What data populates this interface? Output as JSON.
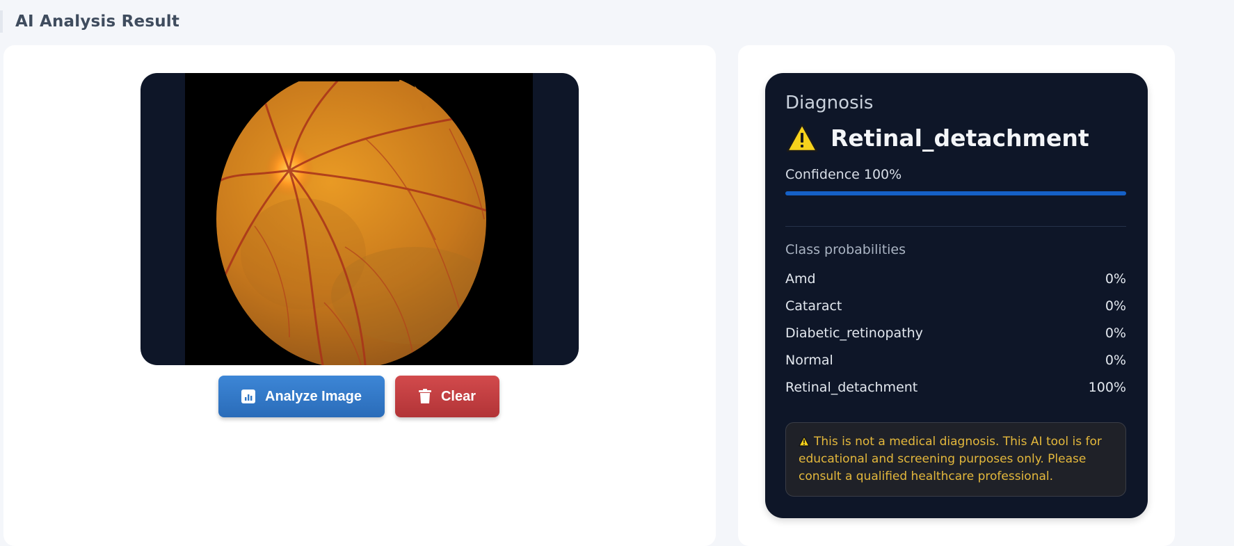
{
  "page": {
    "title": "AI Analysis Result"
  },
  "actions": {
    "analyze_label": "Analyze Image",
    "clear_label": "Clear"
  },
  "icons": {
    "analyze": "chart-icon",
    "clear": "trash-icon",
    "diagnosis": "warning-icon"
  },
  "diagnosis": {
    "label": "Diagnosis",
    "name": "Retinal_detachment",
    "confidence_text": "Confidence 100%",
    "confidence_value": 100
  },
  "probabilities": {
    "title": "Class probabilities",
    "items": [
      {
        "label": "Amd",
        "value": "0%"
      },
      {
        "label": "Cataract",
        "value": "0%"
      },
      {
        "label": "Diabetic_retinopathy",
        "value": "0%"
      },
      {
        "label": "Normal",
        "value": "0%"
      },
      {
        "label": "Retinal_detachment",
        "value": "100%"
      }
    ]
  },
  "disclaimer": {
    "text": "This is not a medical diagnosis. This AI tool is for educational and screening purposes only. Please consult a qualified healthcare professional."
  },
  "colors": {
    "analyze_button": "#2f75c4",
    "clear_button": "#c03d40",
    "panel_background": "#0e1628",
    "confidence_bar": "#1560c6",
    "disclaimer_text": "#e4b83c"
  }
}
